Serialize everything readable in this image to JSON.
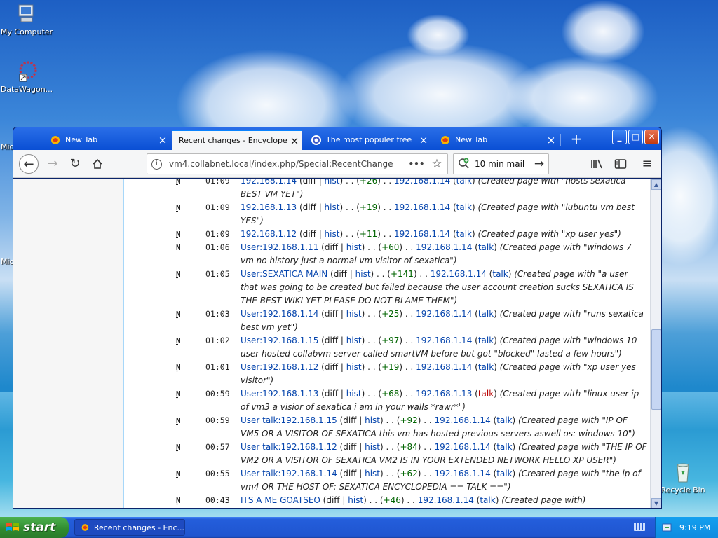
{
  "desktop": {
    "icons": [
      {
        "label": "My Computer",
        "icon": "computer-icon"
      },
      {
        "label": "DataWagon...",
        "icon": "datawagon-icon"
      },
      {
        "label": "Recycle Bin",
        "icon": "recycle-bin-icon"
      }
    ],
    "cut_labels": [
      "Mic",
      "Mic"
    ]
  },
  "browser": {
    "tabs": [
      {
        "label": "New Tab",
        "icon": "newtab-favicon",
        "active": false
      },
      {
        "label": "Recent changes - Encyclopedia",
        "icon": "none",
        "active": true
      },
      {
        "label": "The most populer free Ter",
        "icon": "globe-favicon",
        "active": false
      },
      {
        "label": "New Tab",
        "icon": "newtab-favicon",
        "active": false
      }
    ],
    "new_tab_glyph": "+",
    "window_buttons": {
      "minimize": "_",
      "maximize": "□",
      "close": "✕"
    },
    "url": "vm4.collabnet.local/index.php/Special:RecentChange",
    "url_more": "•••",
    "search_value": "10 min mail",
    "entries": [
      {
        "flag": "N",
        "time": "01:09",
        "page": "192.168.1.14",
        "page_red": false,
        "diff": "diff",
        "hist": "hist",
        "size": "+26",
        "user": "192.168.1.14",
        "talk": "talk",
        "talk_red": false,
        "comment": "Created page with \"hosts sexatica BEST VM YET\""
      },
      {
        "flag": "N",
        "time": "01:09",
        "page": "192.168.1.13",
        "page_red": false,
        "diff": "diff",
        "hist": "hist",
        "size": "+19",
        "user": "192.168.1.14",
        "talk": "talk",
        "talk_red": false,
        "comment": "Created page with \"lubuntu vm best YES\""
      },
      {
        "flag": "N",
        "time": "01:09",
        "page": "192.168.1.12",
        "page_red": false,
        "diff": "diff",
        "hist": "hist",
        "size": "+11",
        "user": "192.168.1.14",
        "talk": "talk",
        "talk_red": false,
        "comment": "Created page with \"xp user yes\""
      },
      {
        "flag": "N",
        "time": "01:06",
        "page": "User:192.168.1.11",
        "page_red": false,
        "diff": "diff",
        "hist": "hist",
        "size": "+60",
        "user": "192.168.1.14",
        "talk": "talk",
        "talk_red": false,
        "comment": "Created page with \"windows 7 vm no history just a normal vm visitor of sexatica\""
      },
      {
        "flag": "N",
        "time": "01:05",
        "page": "User:SEXATICA MAIN",
        "page_red": false,
        "diff": "diff",
        "hist": "hist",
        "size": "+141",
        "user": "192.168.1.14",
        "talk": "talk",
        "talk_red": false,
        "comment": "Created page with \"a user that was going to be created but failed because the user account creation sucks SEXATICA IS THE BEST WIKI YET PLEASE DO NOT BLAME THEM\""
      },
      {
        "flag": "N",
        "time": "01:03",
        "page": "User:192.168.1.14",
        "page_red": false,
        "diff": "diff",
        "hist": "hist",
        "size": "+25",
        "user": "192.168.1.14",
        "talk": "talk",
        "talk_red": false,
        "comment": "Created page with \"runs sexatica best vm yet\""
      },
      {
        "flag": "N",
        "time": "01:02",
        "page": "User:192.168.1.15",
        "page_red": false,
        "diff": "diff",
        "hist": "hist",
        "size": "+97",
        "user": "192.168.1.14",
        "talk": "talk",
        "talk_red": false,
        "comment": "Created page with \"windows 10 user hosted collabvm server called smartVM before but got \"blocked\" lasted a few hours\""
      },
      {
        "flag": "N",
        "time": "01:01",
        "page": "User:192.168.1.12",
        "page_red": false,
        "diff": "diff",
        "hist": "hist",
        "size": "+19",
        "user": "192.168.1.14",
        "talk": "talk",
        "talk_red": false,
        "comment": "Created page with \"xp user yes visitor\""
      },
      {
        "flag": "N",
        "time": "00:59",
        "page": "User:192.168.1.13",
        "page_red": false,
        "diff": "diff",
        "hist": "hist",
        "size": "+68",
        "user": "192.168.1.13",
        "talk": "talk",
        "talk_red": true,
        "comment": "Created page with \"linux user ip of vm3 a visior of sexatica i am in your walls *rawr*\""
      },
      {
        "flag": "N",
        "time": "00:59",
        "page": "User talk:192.168.1.15",
        "page_red": false,
        "diff": "diff",
        "hist": "hist",
        "size": "+92",
        "user": "192.168.1.14",
        "talk": "talk",
        "talk_red": false,
        "comment": "Created page with \"IP OF VM5 OR A VISITOR OF SEXATICA this vm has hosted previous servers aswell os: windows 10\""
      },
      {
        "flag": "N",
        "time": "00:57",
        "page": "User talk:192.168.1.12",
        "page_red": false,
        "diff": "diff",
        "hist": "hist",
        "size": "+84",
        "user": "192.168.1.14",
        "talk": "talk",
        "talk_red": false,
        "comment": "Created page with \"THE IP OF VM2 OR A VISITOR OF SEXATICA VM2 IS IN YOUR EXTENDED NETWORK HELLO XP USER\""
      },
      {
        "flag": "N",
        "time": "00:55",
        "page": "User talk:192.168.1.14",
        "page_red": false,
        "diff": "diff",
        "hist": "hist",
        "size": "+62",
        "user": "192.168.1.14",
        "talk": "talk",
        "talk_red": false,
        "comment": "Created page with \"the ip of vm4 OR THE HOST OF: SEXATICA ENCYCLOPEDIA == TALK ==\""
      },
      {
        "flag": "N",
        "time": "00:43",
        "page": "ITS A ME GOATSEO",
        "page_red": false,
        "diff": "diff",
        "hist": "hist",
        "size": "+46",
        "user": "192.168.1.14",
        "talk": "talk",
        "talk_red": false,
        "comment": "Created page with"
      }
    ]
  },
  "taskbar": {
    "start_label": "start",
    "task_label": "Recent changes - Enc...",
    "clock": "9:19 PM"
  },
  "colors": {
    "link": "#0645ad",
    "redlink": "#ba0000",
    "positive": "#006400",
    "xp_blue": "#245edb"
  }
}
